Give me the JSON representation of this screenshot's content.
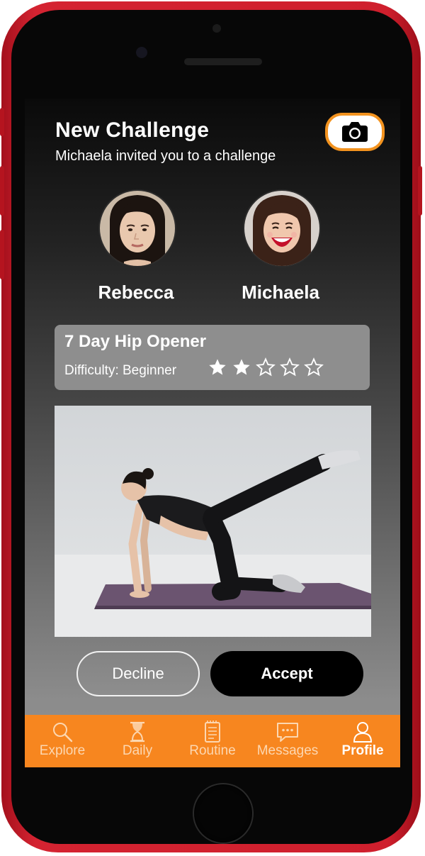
{
  "header": {
    "title": "New Challenge",
    "subtitle": "Michaela invited you to a challenge",
    "camera_icon": "camera-icon"
  },
  "participants": [
    {
      "name": "Rebecca"
    },
    {
      "name": "Michaela"
    }
  ],
  "challenge": {
    "title": "7 Day Hip Opener",
    "difficulty": "Difficulty: Beginner",
    "rating": 2,
    "rating_max": 5
  },
  "actions": {
    "decline": "Decline",
    "accept": "Accept"
  },
  "tabs": [
    {
      "label": "Explore",
      "icon": "search-icon"
    },
    {
      "label": "Daily",
      "icon": "hourglass-icon"
    },
    {
      "label": "Routine",
      "icon": "notepad-icon"
    },
    {
      "label": "Messages",
      "icon": "chat-icon"
    },
    {
      "label": "Profile",
      "icon": "person-icon",
      "active": true
    }
  ],
  "colors": {
    "accent": "#f7861f",
    "device": "#cf1f2d"
  }
}
